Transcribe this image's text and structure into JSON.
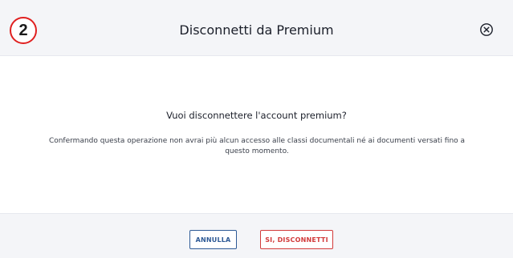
{
  "dialog": {
    "step_number": "2",
    "title": "Disconnetti da Premium",
    "close_icon": "close-circle-icon",
    "question": "Vuoi disconnettere l'account premium?",
    "description": "Confermando questa operazione non avrai più alcun accesso alle classi documentali né ai documenti versati fino a questo momento.",
    "buttons": {
      "cancel_label": "ANNULLA",
      "confirm_label": "SI, DISCONNETTI"
    }
  },
  "colors": {
    "header_bg": "#f4f5f8",
    "cancel_accent": "#2e5a96",
    "confirm_accent": "#d23a3a",
    "badge_ring": "#e02020"
  }
}
